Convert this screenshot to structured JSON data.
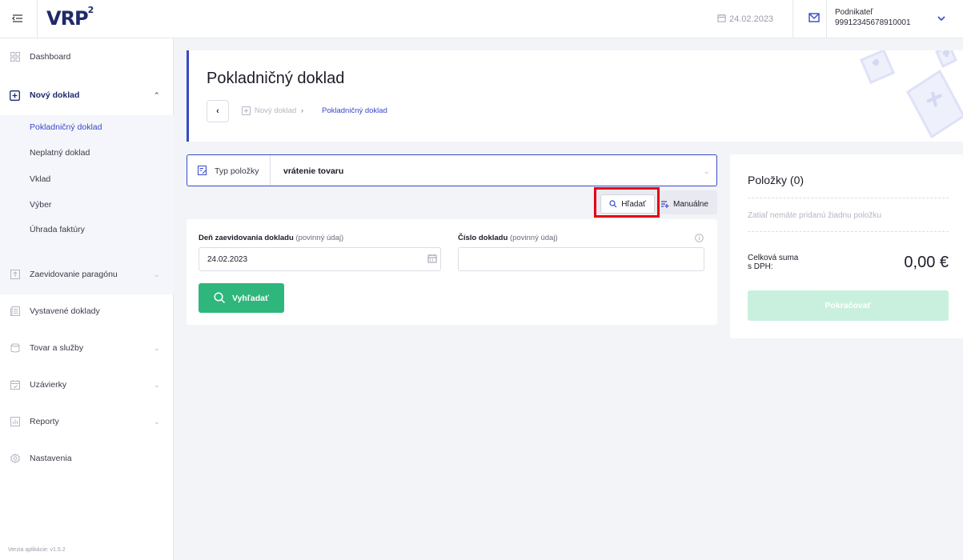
{
  "topbar": {
    "logo_main": "VRP",
    "logo_sup": "2",
    "date": "24.02.2023",
    "user_role": "Podnikateľ",
    "user_id": "99912345678910001"
  },
  "sidebar": {
    "items": [
      {
        "label": "Dashboard",
        "icon": "dashboard-icon"
      },
      {
        "label": "Nový doklad",
        "icon": "plus-square-icon"
      },
      {
        "label": "Zaevidovanie paragónu",
        "icon": "receipt-icon"
      },
      {
        "label": "Vystavené doklady",
        "icon": "documents-icon"
      },
      {
        "label": "Tovar a služby",
        "icon": "box-icon"
      },
      {
        "label": "Uzávierky",
        "icon": "calendar-check-icon"
      },
      {
        "label": "Reporty",
        "icon": "chart-icon"
      },
      {
        "label": "Nastavenia",
        "icon": "gear-icon"
      }
    ],
    "submenu": [
      {
        "label": "Pokladničný doklad"
      },
      {
        "label": "Neplatný doklad"
      },
      {
        "label": "Vklad"
      },
      {
        "label": "Výber"
      },
      {
        "label": "Úhrada faktúry"
      }
    ],
    "version": "Verzia aplikácie: v1.5.2"
  },
  "header": {
    "title": "Pokladničný doklad",
    "breadcrumb": [
      "Nový doklad",
      "Pokladničný doklad"
    ]
  },
  "type_selector": {
    "label": "Typ položky",
    "value": "vrátenie tovaru"
  },
  "mode_toggle": {
    "search_label": "Hľadať",
    "manual_label": "Manuálne"
  },
  "form": {
    "date_label": "Deň zaevidovania dokladu",
    "date_hint": "(povinný údaj)",
    "date_value": "24.02.2023",
    "number_label": "Číslo dokladu",
    "number_hint": "(povinný údaj)",
    "number_value": "",
    "search_button": "Vyhľadať"
  },
  "items_panel": {
    "title": "Položky (0)",
    "empty_text": "Zatiaľ nemáte pridanú žiadnu položku",
    "total_label_1": "Celková suma",
    "total_label_2": "s DPH:",
    "total_value": "0,00 €",
    "continue_button": "Pokračovať"
  },
  "colors": {
    "accent": "#3848c8",
    "brand_dark": "#1f2a6b",
    "brand_green": "#2fb67c",
    "highlight": "#e60012"
  }
}
